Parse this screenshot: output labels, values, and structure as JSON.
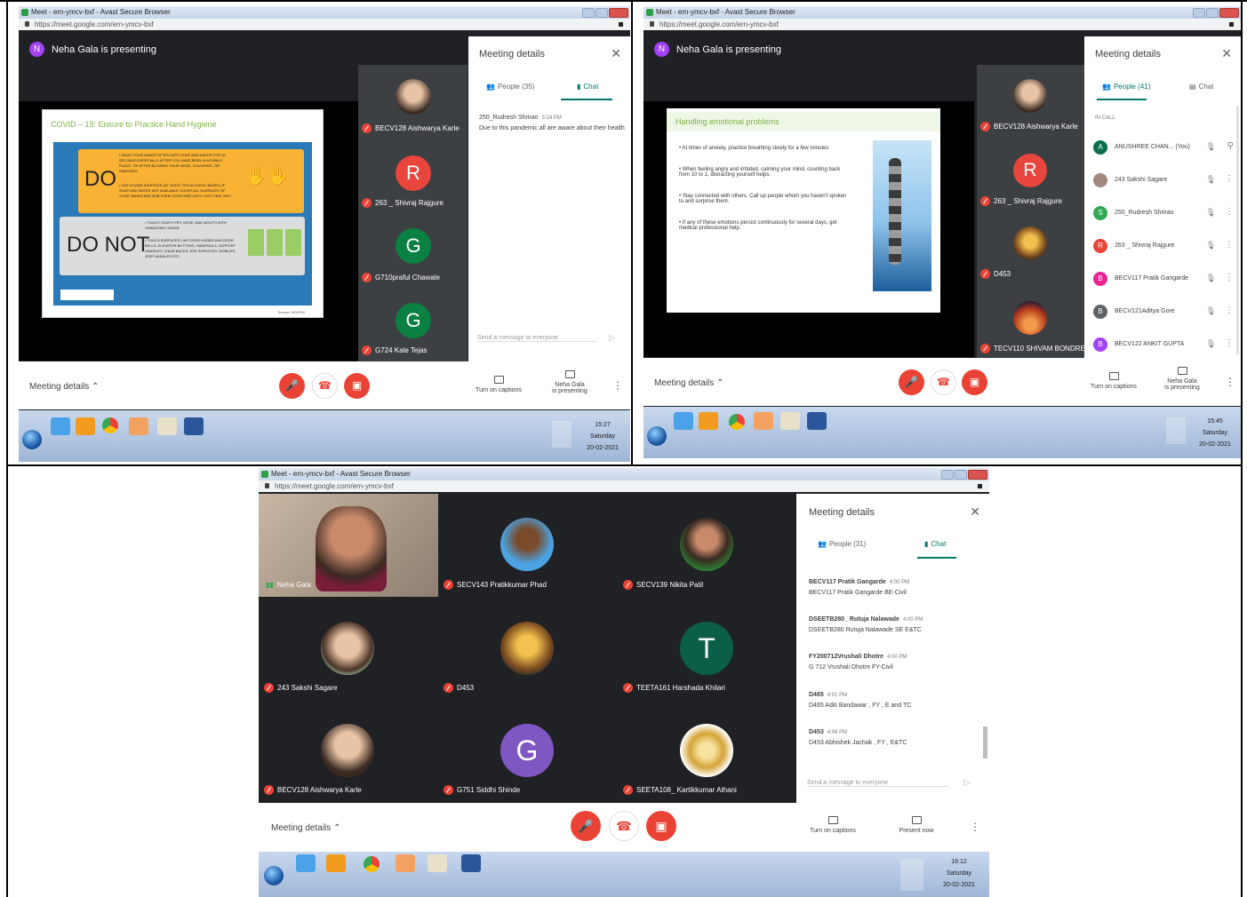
{
  "s1": {
    "title": "Meet - ern-ymcv-bxf - Avast Secure Browser",
    "url": "https://meet.google.com/ern-ymcv-bxf",
    "presenter_initial": "N",
    "presenting": "Neha Gala is presenting",
    "slide": {
      "title": "COVID – 19: Ensure to Practice Hand Hygiene",
      "do_label": "DO",
      "do_text1": "• WASH YOUR HANDS OFTEN WITH SOAP AND WATER FOR 40 SECONDS ESPECIALLY AFTER YOU HAVE BEEN IN A PUBLIC PLACE, OR AFTER BLOWING YOUR NOSE, COUGHING, OR SNEEZING.",
      "do_text2": "• USE A HAND SANITIZER (AT LEAST 70% ALCOHOL BASED) IF SOAP AND WATER NOT AVAILABLE COVER ALL SURFACES OF YOUR HANDS AND RUB THEM TOGETHER UNTIL THEY FEEL DRY.",
      "donot_label": "DO NOT",
      "donot_text1": "• TOUCH YOUR EYES, NOSE, AND MOUTH WITH UNWASHED HANDS.",
      "donot_text2": "• TOUCH SURFACES LIKE DOOR KNOBS AND DOOR BELLS, ELEVATOR BUTTONS, HANDRAILS, SUPPORT HANDLES, CHAIR BACKS, ATM SURFACES, MOBILES, JEEP HANDLES ETC",
      "source": "Source: MOHFW"
    },
    "tiles": [
      {
        "name": "BECV128 Aishwarya Karle",
        "initial": ""
      },
      {
        "name": "263 _ Shivraj Rajgure",
        "initial": "R"
      },
      {
        "name": "G710praful Chawale",
        "initial": "G"
      },
      {
        "name": "G724 Kale Tejas",
        "initial": "G"
      }
    ],
    "panel": {
      "title": "Meeting details",
      "people_tab": "People (35)",
      "chat_tab": "Chat",
      "msg_sender": "250_Rudresh Shrirao",
      "msg_time": "3:24 PM",
      "msg_text": "Due to this pandemic all are aware about their health",
      "send_placeholder": "Send a message to everyone"
    },
    "bottom": {
      "meeting_details": "Meeting details",
      "captions": "Turn on captions",
      "presenting_1": "Neha Gala",
      "presenting_2": "is presenting"
    },
    "clock": {
      "time": "15:27",
      "day": "Saturday",
      "date": "20-02-2021"
    }
  },
  "s2": {
    "title": "Meet - ern-ymcv-bxf - Avast Secure Browser",
    "url": "https://meet.google.com/ern-ymcv-bxf",
    "presenter_initial": "N",
    "presenting": "Neha Gala is presenting",
    "slide": {
      "title": "Handling emotional problems",
      "b1": "• At times of anxiety, practice breathing slowly for a few minutes",
      "b2": "• When feeling angry and irritated, calming your mind, counting back from 10 to 1, distracting yourself helps.",
      "b3": "• Stay connected with others. Call up people whom you haven't spoken to and surprise them.",
      "b4": "• If any of these emotions persist continuously for several days, get medical professional help."
    },
    "tiles": [
      {
        "name": "BECV128 Aishwarya Karle",
        "initial": ""
      },
      {
        "name": "263 _ Shivraj Rajgure",
        "initial": "R"
      },
      {
        "name": "D453",
        "initial": ""
      },
      {
        "name": "TECV110 SHIVAM BONDRE",
        "initial": ""
      }
    ],
    "panel": {
      "title": "Meeting details",
      "people_tab": "People (41)",
      "chat_tab": "Chat",
      "in_call": "IN CALL",
      "people": [
        {
          "initial": "A",
          "name": "ANUSHREE CHAN... (You)",
          "color": "#0b6e4f"
        },
        {
          "initial": "",
          "name": "243 Sakshi Sagare",
          "color": "#a1887f"
        },
        {
          "initial": "S",
          "name": "250_Rudresh Shrirao",
          "color": "#33a852"
        },
        {
          "initial": "R",
          "name": "263 _ Shivraj Rajgure",
          "color": "#e8453c"
        },
        {
          "initial": "B",
          "name": "BECV117 Pratik Gangarde",
          "color": "#e52592"
        },
        {
          "initial": "B",
          "name": "BECV121Aditya Gore",
          "color": "#5f6368"
        },
        {
          "initial": "B",
          "name": "BECV122 ANKIT GUPTA",
          "color": "#a142f4"
        }
      ]
    },
    "bottom": {
      "meeting_details": "Meeting details",
      "captions": "Turn on captions",
      "presenting_1": "Neha Gala",
      "presenting_2": "is presenting"
    },
    "clock": {
      "time": "15:45",
      "day": "Saturday",
      "date": "20-02-2021"
    }
  },
  "s3": {
    "title": "Meet - ern-ymcv-bxf - Avast Secure Browser",
    "url": "https://meet.google.com/ern-ymcv-bxf",
    "grid": [
      {
        "name": "Neha Gala",
        "initial": ""
      },
      {
        "name": "SECV143 Pratikkumar Phad",
        "initial": ""
      },
      {
        "name": "SECV139 Nikita Patil",
        "initial": ""
      },
      {
        "name": "243 Sakshi Sagare",
        "initial": ""
      },
      {
        "name": "D453",
        "initial": ""
      },
      {
        "name": "TEETA161 Harshada Khilari",
        "initial": "T"
      },
      {
        "name": "BECV128 Aishwarya Karle",
        "initial": ""
      },
      {
        "name": "G751 Siddhi Shinde",
        "initial": "G"
      },
      {
        "name": "SEETA108_ Kartikkumar Athani",
        "initial": ""
      }
    ],
    "panel": {
      "title": "Meeting details",
      "people_tab": "People (31)",
      "chat_tab": "Chat",
      "messages": [
        {
          "sender": "BECV117 Pratik Gangarde",
          "time": "4:00 PM",
          "text": "BECV117 Pratik Gangarde BE-Civil"
        },
        {
          "sender": "DSEETB280_ Rutuja Nalawade",
          "time": "4:00 PM",
          "text": "DSEETB280 Rutuja Nalawade SE E&TC"
        },
        {
          "sender": "FY200712Vrushali Dhotre",
          "time": "4:00 PM",
          "text": "G 712 Vrushali Dhotre FY-Civil"
        },
        {
          "sender": "D465",
          "time": "4:01 PM",
          "text": "D465 Aditi Bandawar , FY , E and TC"
        },
        {
          "sender": "D453",
          "time": "4:06 PM",
          "text": "D453 Abhishek Jachak , FY , E&TC"
        }
      ],
      "send_placeholder": "Send a message to everyone"
    },
    "bottom": {
      "meeting_details": "Meeting details",
      "captions": "Turn on captions",
      "present_now": "Present now"
    },
    "clock": {
      "time": "16:12",
      "day": "Saturday",
      "date": "20-02-2021"
    }
  }
}
